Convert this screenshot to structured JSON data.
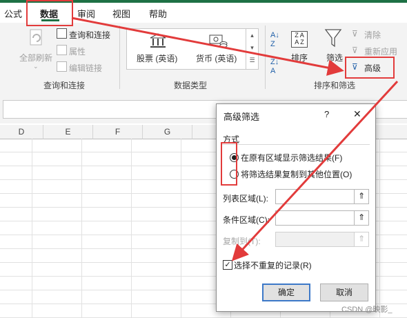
{
  "ribbon": {
    "tabs": [
      "公式",
      "数据",
      "审阅",
      "视图",
      "帮助"
    ],
    "active_tab": "数据",
    "groups": {
      "queries": {
        "label": "查询和连接",
        "refresh_all": "全部刷新",
        "queries_connections": "查询和连接",
        "properties": "属性",
        "edit_links": "编辑链接"
      },
      "data_types": {
        "label": "数据类型",
        "stocks": "股票 (英语)",
        "currency": "货币 (英语)"
      },
      "sort_filter": {
        "label": "排序和筛选",
        "sort": "排序",
        "filter": "筛选",
        "clear": "清除",
        "reapply": "重新应用",
        "advanced": "高级"
      }
    }
  },
  "sheet": {
    "columns": [
      "D",
      "E",
      "F",
      "G"
    ]
  },
  "dialog": {
    "title": "高级筛选",
    "help": "?",
    "close": "✕",
    "mode_label": "方式",
    "options": [
      {
        "label": "在原有区域显示筛选结果(F)",
        "selected": true
      },
      {
        "label": "将筛选结果复制到其他位置(O)",
        "selected": false
      }
    ],
    "list_range_label": "列表区域(L):",
    "criteria_range_label": "条件区域(C):",
    "copy_to_label": "复制到(T):",
    "unique_records_label": "选择不重复的记录(R)",
    "unique_records_checked": true,
    "ok": "确定",
    "cancel": "取消"
  },
  "watermark": "CSDN @映影_",
  "colors": {
    "excel_green": "#1e7145",
    "annotation_red": "#e23b3b"
  }
}
